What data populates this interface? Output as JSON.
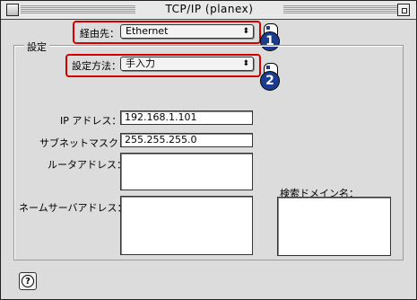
{
  "window": {
    "title": "TCP/IP (planex)"
  },
  "connect_via": {
    "label": "経由先：",
    "value": "Ethernet",
    "arrow": "⬍"
  },
  "settings_group": {
    "label": "設定"
  },
  "configure": {
    "label": "設定方法：",
    "value": "手入力",
    "arrow": "⬍"
  },
  "badges": [
    "1",
    "2"
  ],
  "ip": {
    "label": "IP アドレス：",
    "value": "192.168.1.101"
  },
  "subnet": {
    "label": "サブネットマスク：",
    "value": "255.255.255.0"
  },
  "router": {
    "label": "ルータアドレス：",
    "value": ""
  },
  "dns": {
    "label": "ネームサーバアドレス：",
    "value": ""
  },
  "search_domains": {
    "label": "検索ドメイン名：",
    "value": ""
  },
  "help": {
    "glyph": "?"
  }
}
